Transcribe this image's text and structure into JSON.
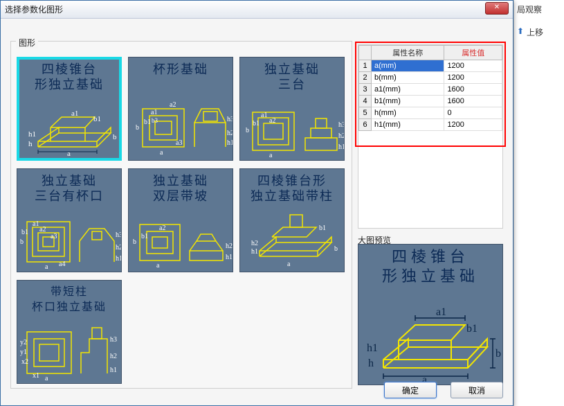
{
  "dialog": {
    "title": "选择参数化图形",
    "close": "✕"
  },
  "side": {
    "tab1_suffix": "观察",
    "tab1_icon": "局",
    "tab2": "上移"
  },
  "groups": {
    "shapes_label": "图形",
    "preview_label": "大图预览"
  },
  "thumbs": [
    {
      "title_l1": "四棱锥台",
      "title_l2": "形独立基础",
      "name": "shape-pyramid-frustum"
    },
    {
      "title_l1": "杯形基础",
      "title_l2": "",
      "name": "shape-cup"
    },
    {
      "title_l1": "独立基础",
      "title_l2": "三台",
      "name": "shape-three-step"
    },
    {
      "title_l1": "独立基础",
      "title_l2": "三台有杯口",
      "name": "shape-three-step-cup"
    },
    {
      "title_l1": "独立基础",
      "title_l2": "双层带坡",
      "name": "shape-double-slope"
    },
    {
      "title_l1": "四棱锥台形",
      "title_l2": "独立基础带柱",
      "name": "shape-frustum-column"
    },
    {
      "title_l1": "带短柱",
      "title_l2": "杯口独立基础",
      "name": "shape-short-col-cup"
    }
  ],
  "attr": {
    "col_name": "属性名称",
    "col_value": "属性值",
    "rows": [
      {
        "n": "1",
        "name": "a(mm)",
        "value": "1200"
      },
      {
        "n": "2",
        "name": "b(mm)",
        "value": "1200"
      },
      {
        "n": "3",
        "name": "a1(mm)",
        "value": "1600"
      },
      {
        "n": "4",
        "name": "b1(mm)",
        "value": "1600"
      },
      {
        "n": "5",
        "name": "h(mm)",
        "value": "0"
      },
      {
        "n": "6",
        "name": "h1(mm)",
        "value": "1200"
      }
    ]
  },
  "preview": {
    "title_l1": "四棱锥台",
    "title_l2": "形独立基础"
  },
  "buttons": {
    "ok": "确定",
    "cancel": "取消"
  },
  "dim_labels": {
    "a": "a",
    "b": "b",
    "a1": "a1",
    "b1": "b1",
    "a2": "a2",
    "a3": "a3",
    "a4": "a4",
    "h": "h",
    "h1": "h1",
    "h2": "h2",
    "h3": "h3",
    "x1": "x1",
    "x2": "x2"
  }
}
